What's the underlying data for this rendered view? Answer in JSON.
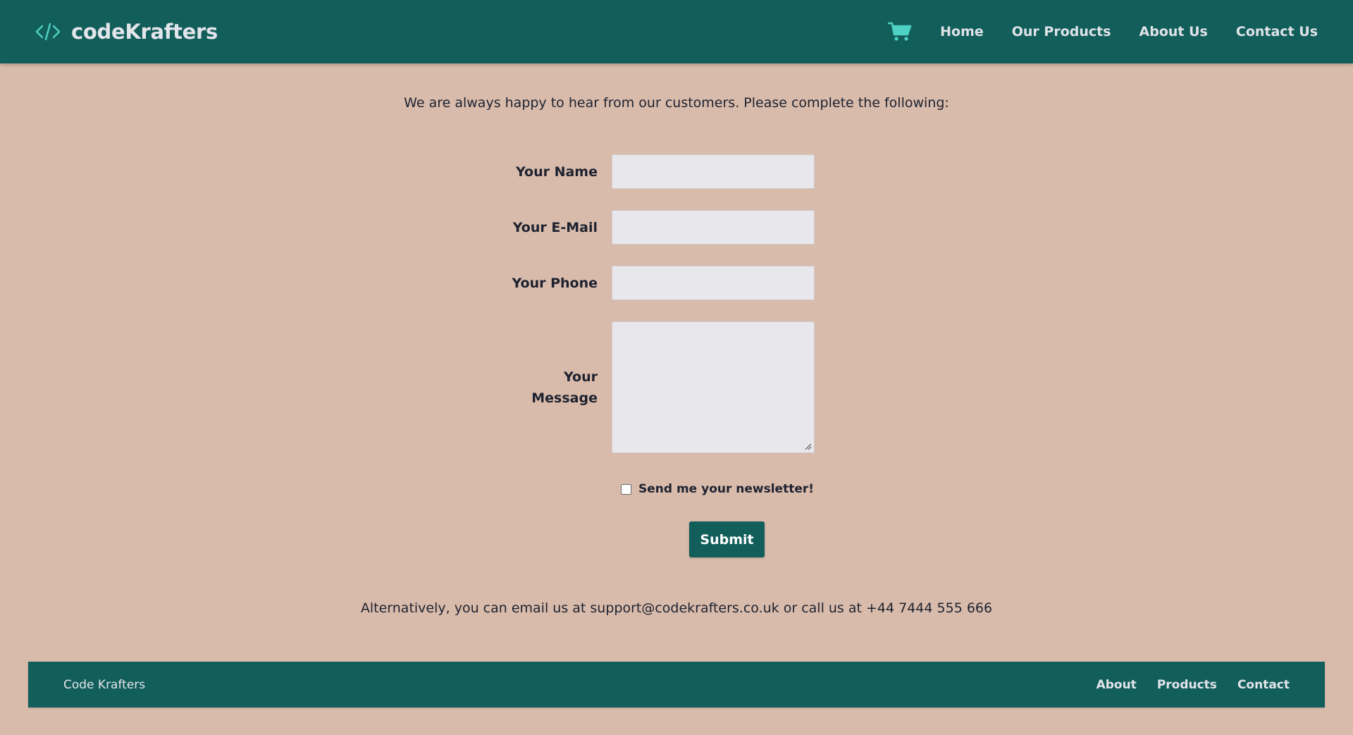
{
  "header": {
    "brand_icon": "code-icon",
    "brand_name": "codeKrafters",
    "cart_icon": "shopping-cart-icon",
    "nav": [
      {
        "label": "Home"
      },
      {
        "label": "Our Products"
      },
      {
        "label": "About Us"
      },
      {
        "label": "Contact Us"
      }
    ]
  },
  "intro": "We are always happy to hear from our customers. Please complete the following:",
  "form": {
    "name_label": "Your Name",
    "name_value": "",
    "email_label": "Your E-Mail",
    "email_value": "",
    "phone_label": "Your Phone",
    "phone_value": "",
    "message_label_line1": "Your",
    "message_label_line2": "Message",
    "message_value": "",
    "newsletter_label": "Send me your newsletter!",
    "newsletter_checked": false,
    "submit_label": "Submit"
  },
  "alt_contact": "Alternatively, you can email us at support@codekrafters.co.uk or call us at +44 7444 555 666",
  "footer": {
    "brand": "Code Krafters",
    "links": [
      {
        "label": "About"
      },
      {
        "label": "Products"
      },
      {
        "label": "Contact"
      }
    ]
  },
  "colors": {
    "header_bg": "#125e5b",
    "page_bg": "#d8bbab",
    "accent": "#4fd1c5",
    "input_bg": "#e7e7ec"
  }
}
